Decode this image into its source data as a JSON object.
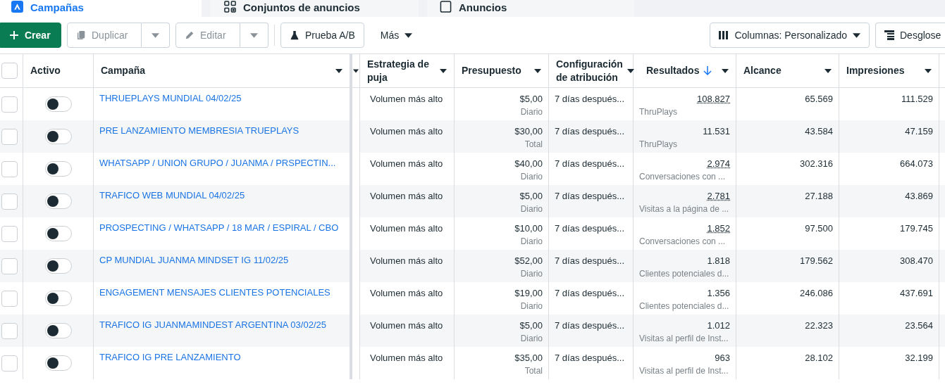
{
  "tabs": [
    {
      "label": "Campañas",
      "selected": true
    },
    {
      "label": "Conjuntos de anuncios",
      "selected": false
    },
    {
      "label": "Anuncios",
      "selected": false
    }
  ],
  "toolbar": {
    "create": "Crear",
    "duplicate": "Duplicar",
    "edit": "Editar",
    "ab_test": "Prueba A/B",
    "more": "Más",
    "columns": "Columnas: Personalizado",
    "breakdown": "Desglose"
  },
  "table": {
    "select_all_checked": false,
    "columns": [
      {
        "label": "Activo"
      },
      {
        "label": "Campaña",
        "sortable": true,
        "sorted": false
      },
      {
        "label": "Estrategia de puja",
        "sortable": true,
        "sorted": false
      },
      {
        "label": "Presupuesto",
        "sortable": true,
        "sorted": false
      },
      {
        "label": "Configuración de atribución",
        "sortable": true,
        "sorted": false
      },
      {
        "label": "Resultados",
        "sortable": true,
        "sorted": true
      },
      {
        "label": "Alcance",
        "sortable": true,
        "sorted": false
      },
      {
        "label": "Impresiones",
        "sortable": true,
        "sorted": false
      }
    ],
    "rows": [
      {
        "checked": false,
        "on": false,
        "campaign": "THRUEPLAYS MUNDIAL 04/02/25",
        "bid": "Volumen más alto",
        "budget": "$5,00",
        "budget_type": "Diario",
        "attribution": "7 días después...",
        "results": "108.827",
        "results_dotted": true,
        "result_type": "ThruPlays",
        "reach": "65.569",
        "impressions": "111.529"
      },
      {
        "checked": false,
        "on": false,
        "campaign": "PRE LANZAMIENTO MEMBRESIA TRUEPLAYS",
        "bid": "Volumen más alto",
        "budget": "$30,00",
        "budget_type": "Total",
        "attribution": "7 días después...",
        "results": "11.531",
        "results_dotted": false,
        "result_type": "ThruPlays",
        "reach": "43.584",
        "impressions": "47.159"
      },
      {
        "checked": false,
        "on": false,
        "campaign": "WHATSAPP / UNION GRUPO / JUANMA / PRSPECTIN...",
        "bid": "Volumen más alto",
        "budget": "$40,00",
        "budget_type": "Diario",
        "attribution": "7 días después...",
        "results": "2.974",
        "results_dotted": true,
        "result_type": "Conversaciones con ...",
        "reach": "302.316",
        "impressions": "664.073"
      },
      {
        "checked": false,
        "on": false,
        "campaign": "TRAFICO WEB MUNDIAL 04/02/25",
        "bid": "Volumen más alto",
        "budget": "$5,00",
        "budget_type": "Diario",
        "attribution": "7 días después...",
        "results": "2.781",
        "results_dotted": true,
        "result_type": "Visitas a la página de ...",
        "reach": "27.188",
        "impressions": "43.869"
      },
      {
        "checked": false,
        "on": false,
        "campaign": "PROSPECTING / WHATSAPP / 18 MAR / ESPIRAL / CBO",
        "bid": "Volumen más alto",
        "budget": "$10,00",
        "budget_type": "Diario",
        "attribution": "7 días después...",
        "results": "1.852",
        "results_dotted": true,
        "result_type": "Conversaciones con ...",
        "reach": "97.500",
        "impressions": "179.745"
      },
      {
        "checked": false,
        "on": false,
        "campaign": "CP MUNDIAL JUANMA MINDSET IG 11/02/25",
        "bid": "Volumen más alto",
        "budget": "$52,00",
        "budget_type": "Diario",
        "attribution": "7 días después...",
        "results": "1.818",
        "results_dotted": false,
        "result_type": "Clientes potenciales d...",
        "reach": "179.562",
        "impressions": "308.470"
      },
      {
        "checked": false,
        "on": false,
        "campaign": "ENGAGEMENT MENSAJES CLIENTES POTENCIALES",
        "bid": "Volumen más alto",
        "budget": "$19,00",
        "budget_type": "Diario",
        "attribution": "7 días después...",
        "results": "1.356",
        "results_dotted": false,
        "result_type": "Clientes potenciales d...",
        "reach": "246.086",
        "impressions": "437.691"
      },
      {
        "checked": false,
        "on": false,
        "campaign": "TRAFICO IG JUANMAMINDEST ARGENTINA 03/02/25",
        "bid": "Volumen más alto",
        "budget": "$5,00",
        "budget_type": "Diario",
        "attribution": "7 días después...",
        "results": "1.012",
        "results_dotted": false,
        "result_type": "Visitas al perfil de Inst...",
        "reach": "22.323",
        "impressions": "23.564"
      },
      {
        "checked": false,
        "on": false,
        "campaign": "TRAFICO IG PRE LANZAMIENTO",
        "bid": "Volumen más alto",
        "budget": "$35,00",
        "budget_type": "Total",
        "attribution": "7 días después...",
        "results": "963",
        "results_dotted": false,
        "result_type": "Visitas al perfil de Inst...",
        "reach": "28.102",
        "impressions": "32.199"
      }
    ]
  }
}
